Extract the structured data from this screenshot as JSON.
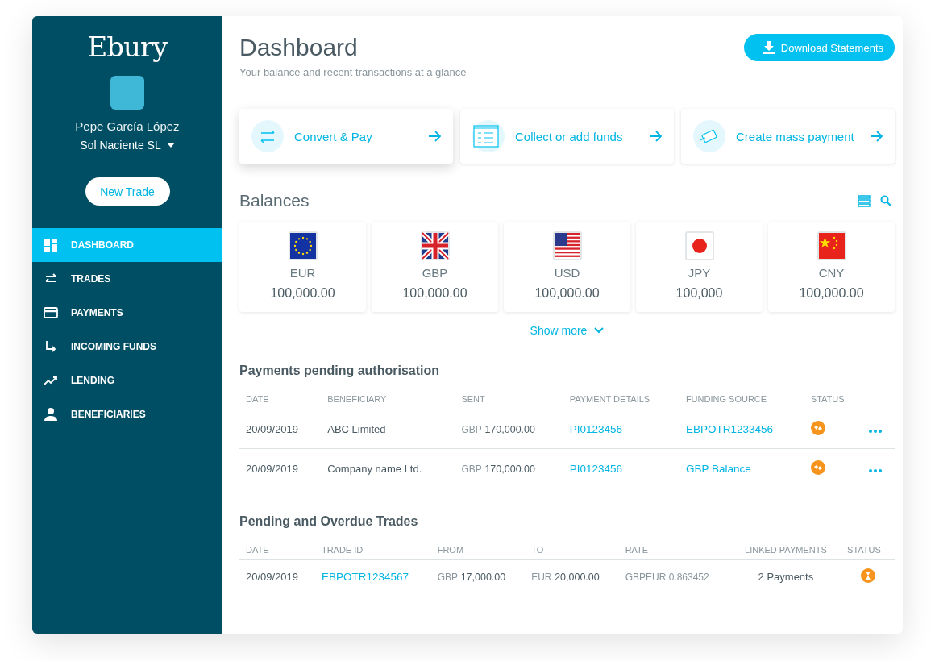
{
  "sidebar": {
    "logo": "Ebury",
    "user_name": "Pepe García López",
    "company": "Sol Naciente SL",
    "new_trade_button": "New Trade",
    "nav": [
      {
        "label": "DASHBOARD",
        "kind": "dashboard",
        "selected": true
      },
      {
        "label": "TRADES",
        "kind": "trades",
        "selected": false
      },
      {
        "label": "PAYMENTS",
        "kind": "payments",
        "selected": false
      },
      {
        "label": "INCOMING FUNDS",
        "kind": "incoming",
        "selected": false
      },
      {
        "label": "LENDING",
        "kind": "lending",
        "selected": false
      },
      {
        "label": "BENEFICIARIES",
        "kind": "beneficiaries",
        "selected": false
      }
    ]
  },
  "header": {
    "title": "Dashboard",
    "subtitle": "Your balance and recent transactions at a glance",
    "download_button": "Download Statements"
  },
  "quick_actions": [
    {
      "label": "Convert & Pay",
      "kind": "convert"
    },
    {
      "label": "Collect or add funds",
      "kind": "collect"
    },
    {
      "label": "Create mass payment",
      "kind": "mass"
    }
  ],
  "balances": {
    "title": "Balances",
    "show_more": "Show more",
    "items": [
      {
        "currency": "EUR",
        "amount": "100,000.00",
        "kind": "eu"
      },
      {
        "currency": "GBP",
        "amount": "100,000.00",
        "kind": "gb"
      },
      {
        "currency": "USD",
        "amount": "100,000.00",
        "kind": "us"
      },
      {
        "currency": "JPY",
        "amount": "100,000",
        "kind": "jp"
      },
      {
        "currency": "CNY",
        "amount": "100,000.00",
        "kind": "cn"
      }
    ]
  },
  "payments": {
    "title": "Payments pending authorisation",
    "columns": [
      "DATE",
      "BENEFICIARY",
      "SENT",
      "PAYMENT DETAILS",
      "FUNDING SOURCE",
      "STATUS"
    ],
    "rows": [
      {
        "date": "20/09/2019",
        "beneficiary": "ABC Limited",
        "sent_currency": "GBP",
        "sent_amount": "170,000.00",
        "payment_details": "PI0123456",
        "funding_source": "EBPOTR1233456",
        "kind": "authorise"
      },
      {
        "date": "20/09/2019",
        "beneficiary": "Company name Ltd.",
        "sent_currency": "GBP",
        "sent_amount": "170,000.00",
        "payment_details": "PI0123456",
        "funding_source": "GBP Balance",
        "kind": "authorise"
      }
    ]
  },
  "trades": {
    "title": "Pending and Overdue Trades",
    "columns": [
      "DATE",
      "TRADE ID",
      "FROM",
      "TO",
      "RATE",
      "LINKED PAYMENTS",
      "STATUS"
    ],
    "rows": [
      {
        "date": "20/09/2019",
        "trade_id": "EBPOTR1234567",
        "from_currency": "GBP",
        "from_amount": "17,000.00",
        "to_currency": "EUR",
        "to_amount": "20,000.00",
        "rate": "GBPEUR 0.863452",
        "linked_payments": "2 Payments",
        "kind": "pending"
      }
    ]
  }
}
